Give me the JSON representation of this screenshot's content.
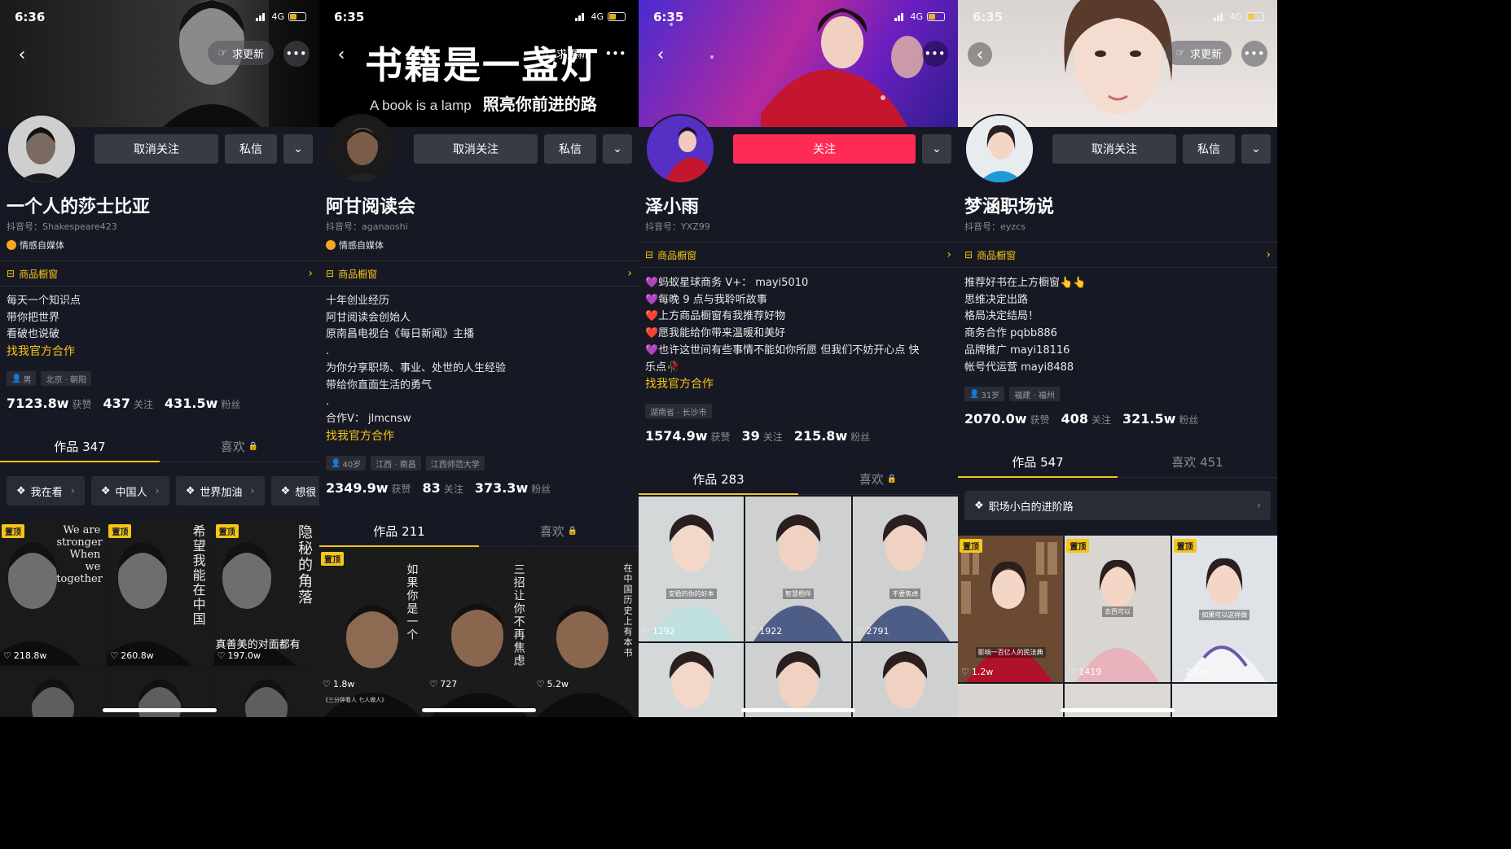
{
  "common": {
    "back_glyph": "‹",
    "more_glyph": "•••",
    "chevron_glyph": "⌄",
    "arrow_glyph": "›",
    "lock_glyph": "🔒",
    "heart_glyph": "♡",
    "network": "4G"
  },
  "p1": {
    "time": "6:35",
    "banner_title": "书籍是一盏灯",
    "banner_sub_en": "A book is a lamp",
    "banner_sub_cn": "照亮你前进的路",
    "update_label": "求更新",
    "btn_follow": "取消关注",
    "btn_msg": "私信",
    "name": "阿甘阅读会",
    "dyid": "抖音号：aganaoshi",
    "tag": "情感自媒体",
    "shop": "商品橱窗",
    "bio": [
      "十年创业经历",
      "阿甘阅读会创始人",
      "原南昌电视台《每日新闻》主播",
      ".",
      "为你分享职场、事业、处世的人生经验",
      "带给你直面生活的勇气",
      ".",
      "合作V：  jlmcnsw"
    ],
    "coop": "找我官方合作",
    "chips": [
      "40岁",
      "江西 · 南昌",
      "江西师范大学"
    ],
    "stats": {
      "likes": "2349.9w",
      "likes_l": "获赞",
      "following": "83",
      "following_l": "关注",
      "fans": "373.3w",
      "fans_l": "粉丝"
    },
    "tab_works": "作品 211",
    "tab_likes": "喜欢",
    "pin": "置顶",
    "cells": [
      {
        "likes": "1.8w",
        "vtext": "如果你是一个",
        "caption": "《三分钟看人 七人做人》"
      },
      {
        "likes": "727",
        "vtext": "三招让你不再焦虑"
      },
      {
        "likes": "5.2w",
        "vtext": "在中国历史上有本书"
      }
    ]
  },
  "p2": {
    "time": "6:35",
    "btn_follow": "关注",
    "name": "泽小雨",
    "dyid": "抖音号：YXZ99",
    "shop": "商品橱窗",
    "bio": [
      "💜蚂蚁星球商务 V+：  mayi5010",
      "💜每晚 9 点与我聆听故事",
      "❤️上方商品橱窗有我推荐好物",
      "❤️愿我能给你带来温暖和美好",
      "💜也许这世间有些事情不能如你所愿 但我们不妨开心点 快",
      "乐点🥀"
    ],
    "coop": "找我官方合作",
    "chips": [
      "湖南省 · 长沙市"
    ],
    "stats": {
      "likes": "1574.9w",
      "likes_l": "获赞",
      "following": "39",
      "following_l": "关注",
      "fans": "215.8w",
      "fans_l": "粉丝"
    },
    "tab_works": "作品 283",
    "tab_likes": "喜欢",
    "cells": [
      {
        "likes": "1292",
        "ovl": "安稳的你的好本"
      },
      {
        "likes": "1922",
        "ovl": "智慧相伴"
      },
      {
        "likes": "2791",
        "ovl": "不要焦虑"
      }
    ]
  },
  "p3": {
    "time": "6:35",
    "update_label": "求更新",
    "btn_follow": "取消关注",
    "btn_msg": "私信",
    "name": "梦涵职场说",
    "dyid": "抖音号：eyzcs",
    "shop": "商品橱窗",
    "bio": [
      "推荐好书在上方橱窗👆👆",
      "思维决定出路",
      "格局决定结局！",
      "商务合作 pqbb886",
      "品牌推广 mayi18116",
      "帐号代运营 mayi8488"
    ],
    "chips": [
      "31岁",
      "福建 · 福州"
    ],
    "stats": {
      "likes": "2070.0w",
      "likes_l": "获赞",
      "following": "408",
      "following_l": "关注",
      "fans": "321.5w",
      "fans_l": "粉丝"
    },
    "tab_works": "作品 547",
    "tab_likes": "喜欢 451",
    "collection": "职场小白的进阶路",
    "pin": "置顶",
    "cells": [
      {
        "likes": "1.2w",
        "ovl": "影响一百亿人的民法典"
      },
      {
        "likes": "1419",
        "ovl": "去西可以"
      },
      {
        "likes": "2.1w",
        "ovl": "如果可以这样做"
      }
    ]
  },
  "p4": {
    "time": "6:36",
    "update_label": "求更新",
    "btn_follow": "取消关注",
    "btn_msg": "私信",
    "name": "一个人的莎士比亚",
    "dyid": "抖音号：Shakespeare423",
    "tag": "情感自媒体",
    "shop": "商品橱窗",
    "bio": [
      "每天一个知识点",
      "带你把世界",
      "看破也说破"
    ],
    "coop": "找我官方合作",
    "chips": [
      "男",
      "北京 · 朝阳"
    ],
    "stats": {
      "likes": "7123.8w",
      "likes_l": "获赞",
      "following": "437",
      "following_l": "关注",
      "fans": "431.5w",
      "fans_l": "粉丝"
    },
    "tab_works": "作品 347",
    "tab_likes": "喜欢",
    "pills": [
      "我在看",
      "中国人",
      "世界加油",
      "想很"
    ],
    "pin": "置顶",
    "cells": [
      {
        "likes": "218.8w",
        "vtext_en": "We are stronger When we together"
      },
      {
        "likes": "260.8w",
        "vtext": "希望我能在中国"
      },
      {
        "likes": "197.0w",
        "vtext": "隐秘的角落",
        "caption2": "真善美的对面都有"
      }
    ]
  }
}
